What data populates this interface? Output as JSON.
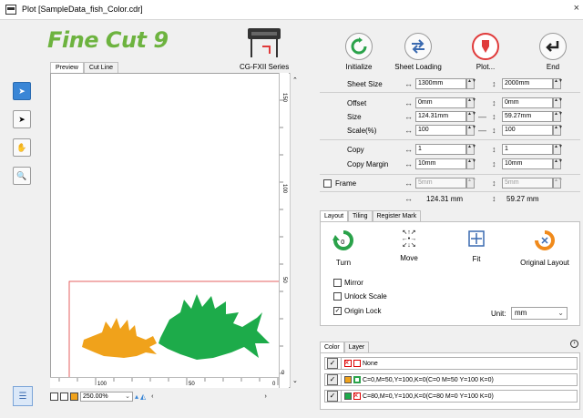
{
  "window": {
    "title": "Plot [SampleData_fish_Color.cdr]",
    "close_glyph": "×"
  },
  "brand": {
    "logo_text": "Fine Cut 9",
    "plotter_model": "CG-FXII Series"
  },
  "toolbar": {
    "initialize": "Initialize",
    "sheet_loading": "Sheet Loading",
    "plot": "Plot...",
    "end": "End"
  },
  "view_tabs": {
    "preview": "Preview",
    "cut_line": "Cut Line"
  },
  "tools": [
    "pointer-icon",
    "node-pointer-icon",
    "hand-icon",
    "zoom-icon"
  ],
  "rulers": {
    "vertical_labels": [
      "150",
      "100",
      "50",
      "0"
    ],
    "horizontal_labels": [
      "100",
      "50",
      "0"
    ]
  },
  "status": {
    "zoom": "250.00%"
  },
  "settings": {
    "sheet_size": {
      "label": "Sheet Size",
      "w": "1300mm",
      "h": "2000mm"
    },
    "offset": {
      "label": "Offset",
      "w": "0mm",
      "h": "0mm"
    },
    "size": {
      "label": "Size",
      "w": "124.31mm",
      "h": "59.27mm"
    },
    "scale": {
      "label": "Scale(%)",
      "w": "100",
      "h": "100"
    },
    "copy": {
      "label": "Copy",
      "w": "1",
      "h": "1"
    },
    "copy_margin": {
      "label": "Copy Margin",
      "w": "10mm",
      "h": "10mm"
    },
    "frame": {
      "label": "Frame",
      "w": "5mm",
      "h": "5mm"
    },
    "totals": {
      "w": "124.31 mm",
      "h": "59.27 mm"
    }
  },
  "layout_tabs": [
    "Layout",
    "Tiling",
    "Register Mark"
  ],
  "layout": {
    "turn": "Turn",
    "turn_value": "0",
    "move": "Move",
    "fit": "Fit",
    "original_layout": "Original Layout",
    "mirror": "Mirror",
    "unlock_scale": "Unlock Scale",
    "origin_lock": "Origin Lock",
    "unit_label": "Unit:",
    "unit_value": "mm"
  },
  "color_tabs": [
    "Color",
    "Layer"
  ],
  "colors": [
    {
      "text": "None"
    },
    {
      "text": "C=0,M=50,Y=100,K=0(C=0 M=50 Y=100 K=0)"
    },
    {
      "text": "C=80,M=0,Y=100,K=0(C=80 M=0 Y=100 K=0)"
    }
  ],
  "palette": {
    "orange": "#f0a21b",
    "green": "#1dab4a",
    "frame_red": "#e03b3b"
  }
}
